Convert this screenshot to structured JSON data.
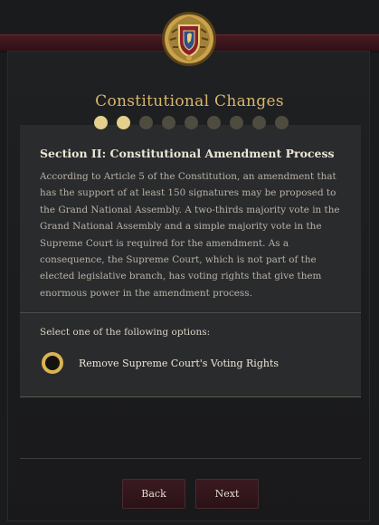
{
  "header": {
    "title": "Constitutional Changes",
    "progress": {
      "total_steps": 9,
      "current_step": 2
    }
  },
  "section": {
    "title": "Section II: Constitutional Amendment Process",
    "body": "According to Article 5 of the Constitution, an amendment that has the support of at least 150 signatures may be proposed to the Grand National Assembly. A two-thirds majority vote in the Grand National Assembly and a simple majority vote in the Supreme Court is required for the amendment. As a consequence, the Supreme Court, which is not part of the elected legislative branch, has voting rights that give them enormous power in the amendment process."
  },
  "options": {
    "prompt": "Select one of the following options:",
    "items": [
      {
        "label": "Remove Supreme Court's Voting Rights",
        "selected": true
      }
    ]
  },
  "buttons": {
    "back_label": "Back",
    "next_label": "Next"
  },
  "colors": {
    "accent_gold": "#d9b66b",
    "button_bg": "#3a1a20",
    "band": "#4a1a22"
  }
}
